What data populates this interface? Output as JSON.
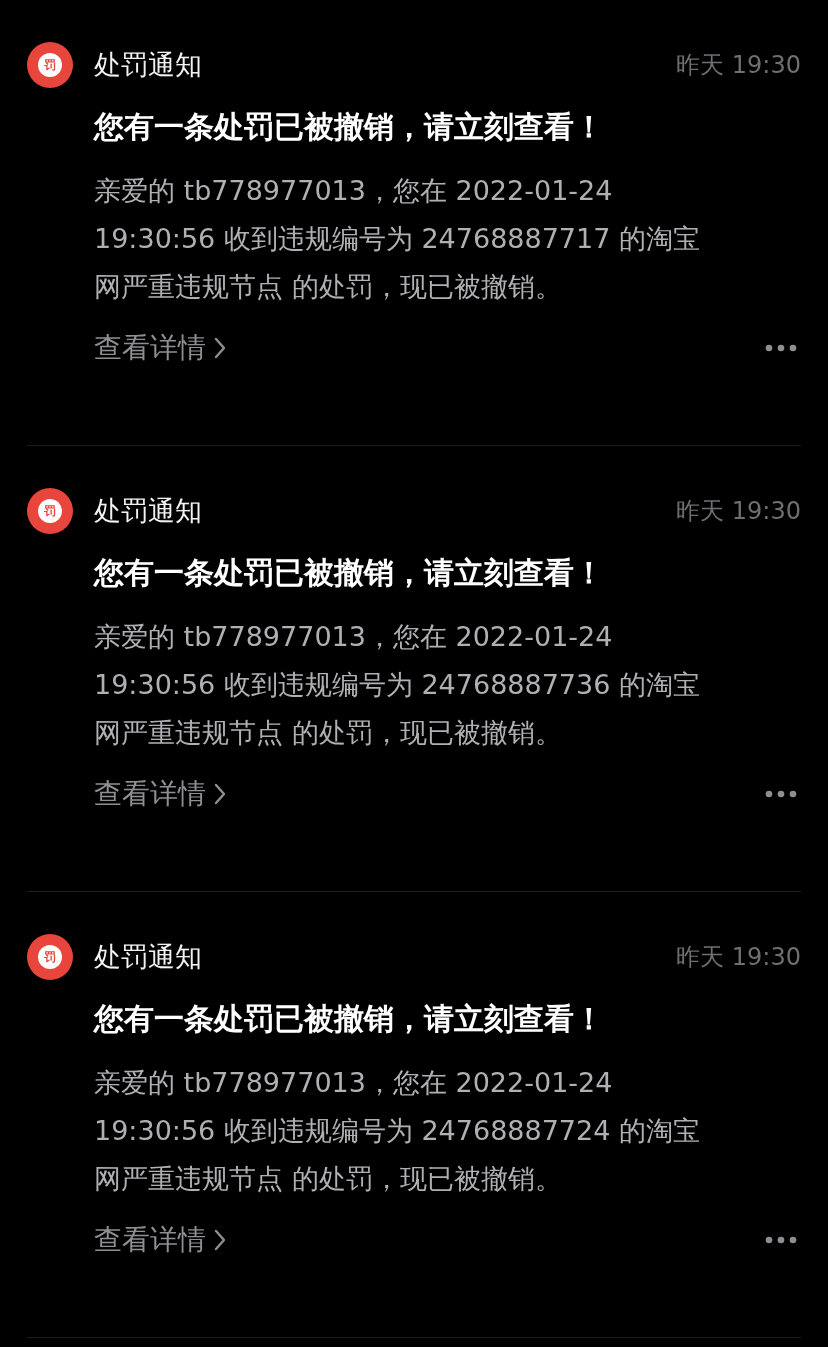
{
  "notifications": [
    {
      "icon_text": "罚",
      "sender": "处罚通知",
      "time": "昨天 19:30",
      "title": "您有一条处罚已被撤销，请立刻查看！",
      "body": "亲爱的 tb778977013，您在 2022-01-24 19:30:56 收到违规编号为 24768887717 的淘宝网严重违规节点 的处罚，现已被撤销。",
      "link": "查看详情"
    },
    {
      "icon_text": "罚",
      "sender": "处罚通知",
      "time": "昨天 19:30",
      "title": "您有一条处罚已被撤销，请立刻查看！",
      "body": "亲爱的 tb778977013，您在 2022-01-24 19:30:56 收到违规编号为 24768887736 的淘宝网严重违规节点 的处罚，现已被撤销。",
      "link": "查看详情"
    },
    {
      "icon_text": "罚",
      "sender": "处罚通知",
      "time": "昨天 19:30",
      "title": "您有一条处罚已被撤销，请立刻查看！",
      "body": "亲爱的 tb778977013，您在 2022-01-24 19:30:56 收到违规编号为 24768887724 的淘宝网严重违规节点 的处罚，现已被撤销。",
      "link": "查看详情"
    }
  ]
}
